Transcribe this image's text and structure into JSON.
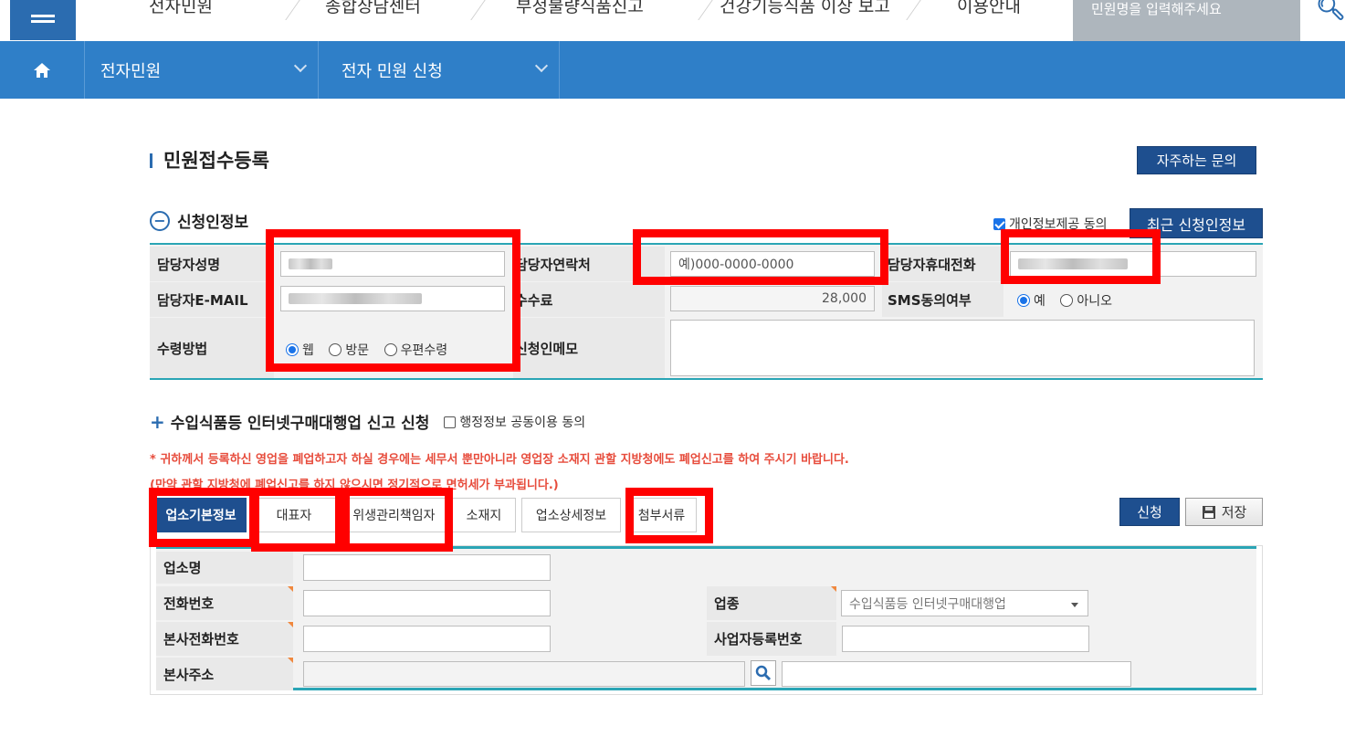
{
  "topnav": {
    "items": [
      "전자민원",
      "종합상담센터",
      "부정불량식품신고",
      "건강기능식품 이상 보고",
      "이용안내"
    ],
    "search_placeholder": "민원명을 입력해주세요"
  },
  "breadcrumb": {
    "level1": "전자민원",
    "level2": "전자 민원 신청"
  },
  "page": {
    "title": "민원접수등록",
    "faq_button": "자주하는 문의"
  },
  "applicant": {
    "section_title": "신청인정보",
    "privacy_consent": "개인정보제공 동의",
    "recent_button": "최근 신청인정보",
    "labels": {
      "name": "담당자성명",
      "contact": "담당자연락처",
      "mobile": "담당자휴대전화",
      "email": "담당자E-MAIL",
      "fee": "수수료",
      "sms": "SMS동의여부",
      "receive": "수령방법",
      "memo": "신청인메모"
    },
    "contact_placeholder": "예)000-0000-0000",
    "fee_value": "28,000",
    "sms_options": [
      "예",
      "아니오"
    ],
    "receive_options": [
      "웹",
      "방문",
      "우편수령"
    ]
  },
  "report": {
    "title": "수입식품등 인터넷구매대행업 신고 신청",
    "admin_consent": "행정정보 공동이용 동의",
    "warning1": "* 귀하께서 등록하신 영업을 폐업하고자 하실 경우에는 세무서 뿐만아니라 영업장 소재지 관할 지방청에도 폐업신고를 하여 주시기 바랍니다.",
    "warning2": "(만약 관할 지방청에 폐업신고를 하지 않으시면 정기적으로 면허세가 부과됩니다.)",
    "tabs": [
      "업소기본정보",
      "대표자",
      "위생관리책임자",
      "소재지",
      "업소상세정보",
      "첨부서류"
    ],
    "apply_button": "신청",
    "save_button": "저장",
    "labels": {
      "biz_name": "업소명",
      "phone": "전화번호",
      "industry": "업종",
      "hq_phone": "본사전화번호",
      "biz_reg_no": "사업자등록번호",
      "hq_address": "본사주소"
    },
    "industry_value": "수입식품등 인터넷구매대행업"
  },
  "colors": {
    "primary": "#2f7fc8",
    "navy": "#1e4f8f",
    "teal": "#2aa5b5",
    "highlight": "#ff0000",
    "warning": "#e74c3c"
  }
}
